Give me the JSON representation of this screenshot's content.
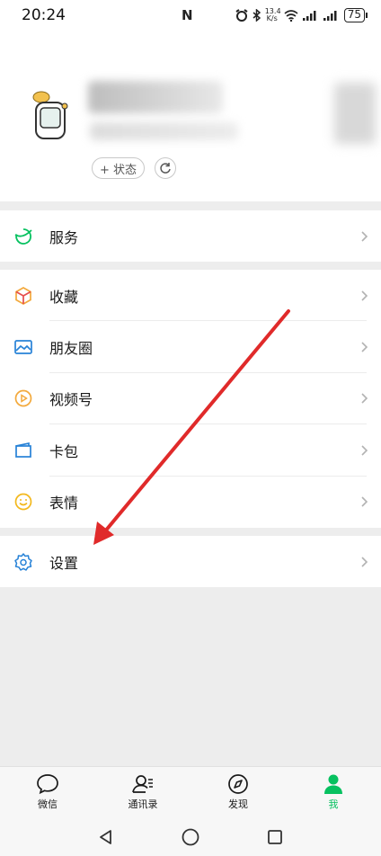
{
  "status_bar": {
    "time": "20:24",
    "nfc": "N",
    "speed_top": "13.4",
    "speed_bottom": "K/s",
    "battery": "75"
  },
  "profile": {
    "status_button": "+ 状态"
  },
  "menu": {
    "service": "服务",
    "favorites": "收藏",
    "moments": "朋友圈",
    "channels": "视频号",
    "cards": "卡包",
    "stickers": "表情",
    "settings": "设置"
  },
  "tabs": [
    {
      "label": "微信",
      "icon": "chat-bubble-icon",
      "active": false
    },
    {
      "label": "通讯录",
      "icon": "contacts-icon",
      "active": false
    },
    {
      "label": "发现",
      "icon": "compass-icon",
      "active": false
    },
    {
      "label": "我",
      "icon": "person-icon",
      "active": true
    }
  ],
  "colors": {
    "accent_green": "#07c160",
    "annotation_red": "#e02a2a",
    "settings_blue": "#2782d7"
  }
}
